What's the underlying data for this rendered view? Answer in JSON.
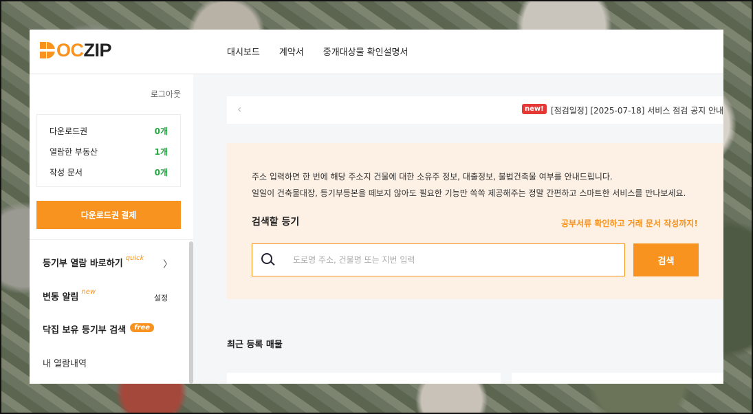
{
  "header": {
    "logo": {
      "part1": "D",
      "part2": "OC",
      "part3": "ZIP"
    },
    "nav": [
      "대시보드",
      "계약서",
      "중개대상물 확인설명서"
    ]
  },
  "sidebar": {
    "logout": "로그아웃",
    "stats": [
      {
        "label": "다운로드권",
        "value": "0개"
      },
      {
        "label": "열람한 부동산",
        "value": "1개"
      },
      {
        "label": "작성 문서",
        "value": "0개"
      }
    ],
    "pay_button": "다운로드권 결제",
    "menu": {
      "quick_view": {
        "label": "등기부 열람 바로하기",
        "tag": "quick"
      },
      "change_alert": {
        "label": "변동 알림",
        "tag": "new",
        "settings": "설정"
      },
      "owned_search": {
        "label": "닥집 보유 등기부 검색",
        "tag": "free"
      },
      "history": {
        "label": "내 열람내역"
      }
    }
  },
  "notice": {
    "badge": "new!",
    "text": "[점검일정] [2025-07-18] 서비스 점검 공지 안내"
  },
  "search_panel": {
    "desc_line1": "주소 입력하면 한 번에 해당 주소지 건물에 대한 소유주 정보, 대출정보, 불법건축물 여부를 안내드립니다.",
    "desc_line2": "일일이 건축물대장, 등기부등본을 떼보지 않아도 필요한 기능만 쏙쏙 제공해주는 정말 간편하고 스마트한 서비스를 만나보세요.",
    "title": "검색할 등기",
    "promo": "공부서류 확인하고 거래 문서 작성까지!",
    "placeholder": "도로명 주소, 건물명 또는 지번 입력",
    "button": "검색"
  },
  "recent": {
    "title": "최근 등록 매물"
  },
  "colors": {
    "accent": "#f7931e",
    "stat_value": "#28a745",
    "badge": "#e53935",
    "panel_bg": "#fdf0e4"
  }
}
